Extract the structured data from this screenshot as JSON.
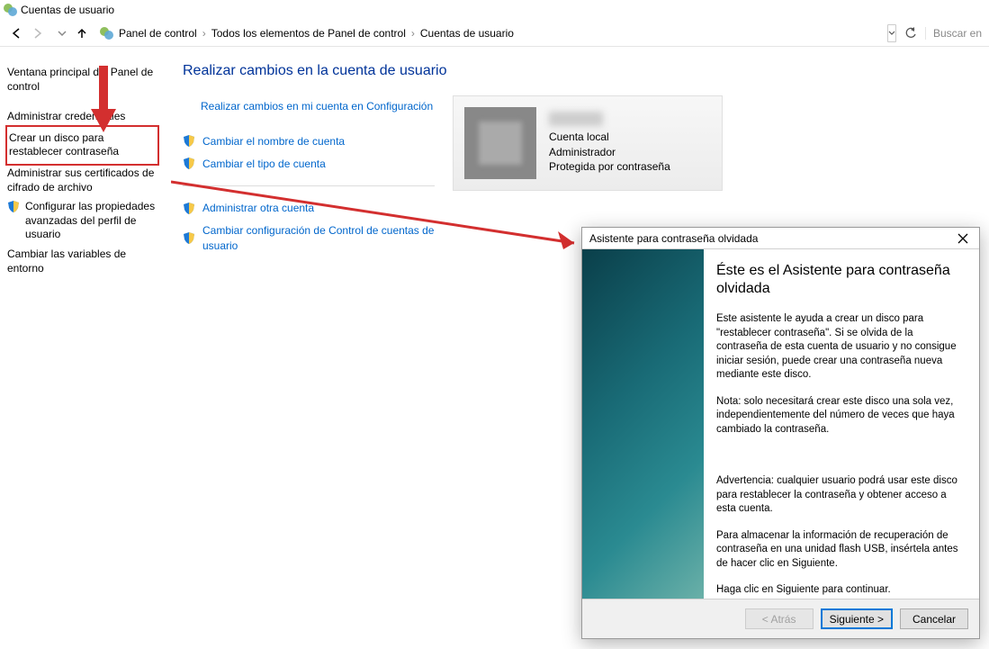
{
  "title_bar": {
    "title": "Cuentas de usuario"
  },
  "nav": {
    "breadcrumb": [
      "Panel de control",
      "Todos los elementos de Panel de control",
      "Cuentas de usuario"
    ],
    "search_placeholder": "Buscar en"
  },
  "sidebar": {
    "items": [
      {
        "label": "Ventana principal del Panel de control",
        "type": "plain"
      },
      {
        "label": "Administrar credenciales",
        "type": "plain"
      },
      {
        "label": "Crear un disco para restablecer contraseña",
        "type": "highlight"
      },
      {
        "label": "Administrar sus certificados de cifrado de archivo",
        "type": "plain"
      },
      {
        "label": "Configurar las propiedades avanzadas del perfil de usuario",
        "type": "shield"
      },
      {
        "label": "Cambiar las variables de entorno",
        "type": "plain"
      }
    ]
  },
  "main": {
    "heading": "Realizar cambios en la cuenta de usuario",
    "tasks": [
      {
        "label": "Realizar cambios en mi cuenta en Configuración",
        "shield": false,
        "indent": true
      },
      {
        "label": "Cambiar el nombre de cuenta",
        "shield": true
      },
      {
        "label": "Cambiar el tipo de cuenta",
        "shield": true
      }
    ],
    "tasks2": [
      {
        "label": "Administrar otra cuenta",
        "shield": true
      },
      {
        "label": "Cambiar configuración de Control de cuentas de usuario",
        "shield": true
      }
    ],
    "user": {
      "type": "Cuenta local",
      "role": "Administrador",
      "protected": "Protegida por contraseña"
    }
  },
  "wizard": {
    "title": "Asistente para contraseña olvidada",
    "heading": "Éste es el Asistente para contraseña olvidada",
    "paragraphs": [
      "Este asistente le ayuda a crear un disco para \"restablecer contraseña\". Si se olvida de la contraseña de esta cuenta de usuario y no consigue iniciar sesión, puede crear una contraseña nueva mediante este disco.",
      "Nota: solo necesitará crear este disco una sola vez, independientemente del número de veces que haya cambiado la contraseña.",
      "Advertencia: cualquier usuario podrá usar este disco para restablecer la contraseña y obtener acceso a esta cuenta.",
      "Para almacenar la información de recuperación de contraseña en una unidad flash USB, insértela antes de hacer clic en Siguiente.",
      "Haga clic en Siguiente para continuar."
    ],
    "buttons": {
      "back": "< Atrás",
      "next": "Siguiente >",
      "cancel": "Cancelar"
    }
  }
}
